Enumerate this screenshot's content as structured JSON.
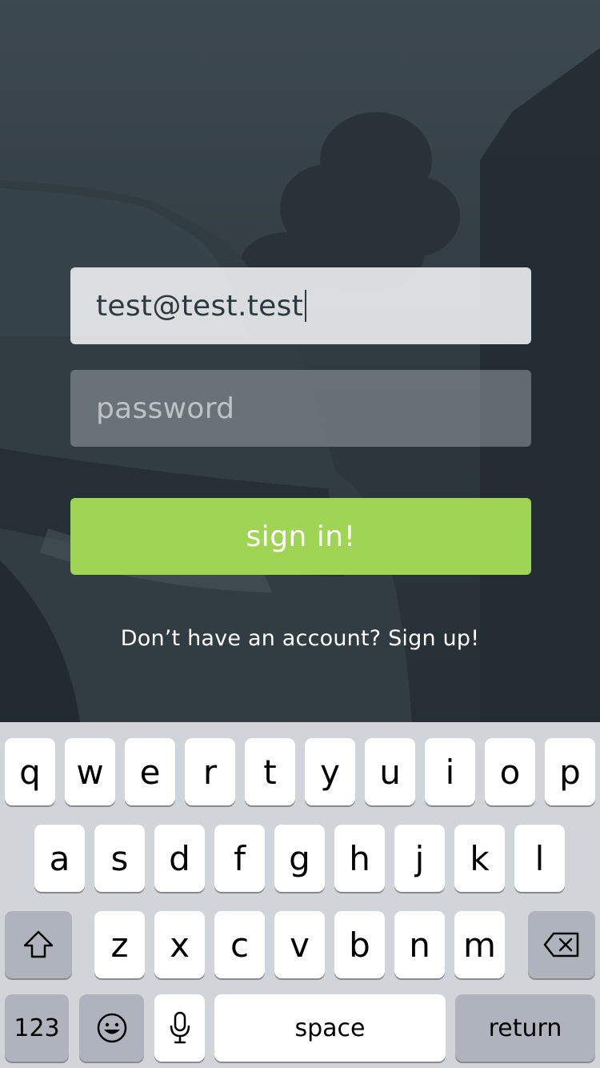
{
  "form": {
    "email_value": "test@test.test",
    "password_placeholder": "password",
    "signin_label": "sign in!",
    "signup_text": "Don’t have an account? Sign up!"
  },
  "keyboard": {
    "row1": [
      "q",
      "w",
      "e",
      "r",
      "t",
      "y",
      "u",
      "i",
      "o",
      "p"
    ],
    "row2": [
      "a",
      "s",
      "d",
      "f",
      "g",
      "h",
      "j",
      "k",
      "l"
    ],
    "row3": [
      "z",
      "x",
      "c",
      "v",
      "b",
      "n",
      "m"
    ],
    "numbers_label": "123",
    "space_label": "space",
    "return_label": "return",
    "icons": {
      "shift": "shift-icon",
      "delete": "backspace-icon",
      "emoji": "emoji-icon",
      "mic": "microphone-icon"
    }
  },
  "colors": {
    "accent": "#9fd455",
    "keyboard_bg": "#d1d4d9",
    "key_dark": "#aeb3bd"
  }
}
